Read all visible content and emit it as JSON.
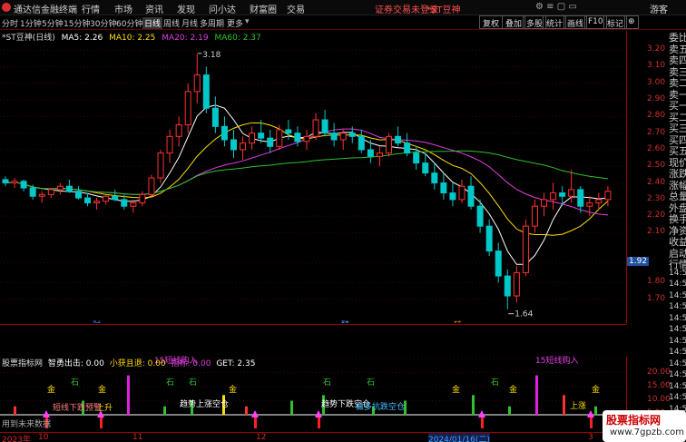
{
  "menubar": {
    "app_title": "通达信金融终端",
    "items": [
      "行情",
      "市场",
      "资讯",
      "发现",
      "问小达",
      "财富圈",
      "交易"
    ],
    "notice": "证券交易未登录",
    "stock_badge": "*ST豆神",
    "guest": "游客"
  },
  "subbar": {
    "periods": [
      "分时",
      "1分钟",
      "5分钟",
      "15分钟",
      "30分钟",
      "60分钟",
      "日线",
      "周线",
      "月线",
      "多周期",
      "更多"
    ],
    "selected": "日线",
    "buttons": [
      "复权",
      "叠加",
      "多股",
      "统计",
      "画线",
      "F10",
      "标记",
      "⊕"
    ]
  },
  "chart_header": {
    "stock": "*ST豆神(日线)",
    "ma5": "MA5: 2.26",
    "ma10": "MA10: 2.25",
    "ma20": "MA20: 2.19",
    "ma60": "MA60: 2.37"
  },
  "y_axis": [
    "3.20",
    "3.10",
    "3.00",
    "2.90",
    "2.80",
    "2.70",
    "2.60",
    "2.50",
    "2.40",
    "2.30",
    "2.20",
    "2.10",
    "1.92",
    "1.80",
    "1.70"
  ],
  "price_labels": {
    "high": "3.18",
    "low": "1.64",
    "current": "1.92"
  },
  "markers": [
    "财",
    "酵",
    "转"
  ],
  "indicator_header": {
    "name": "股票指标网",
    "chuji": "智勇出击: 0.00",
    "xiaohuo": "小获且退: 0.00",
    "zhibiao": "指标: 0.00",
    "get": "GET: 2.35"
  },
  "indicator_y": [
    "20.00",
    "15.00",
    "10.00",
    "5.00",
    "0.00"
  ],
  "indicator_labels": {
    "buy15": "15短线购入",
    "shi": "石",
    "jin": "金",
    "text1": "短线下跌预警",
    "text2": "上升",
    "text3": "趋势上涨空仓",
    "text4": "趋势下跌空仓",
    "text5": "做多抗跌空仓",
    "text6": "上涨",
    "bottom": "用到未来数据"
  },
  "x_axis": [
    "2023年",
    "10",
    "11",
    "12",
    "2024/01/16(二)",
    "3"
  ],
  "side_panel": [
    "委比",
    "卖五",
    "卖四",
    "卖三",
    "卖二",
    "卖一",
    "买一",
    "买二",
    "买三",
    "买四",
    "买五",
    "现价",
    "涨跌",
    "涨幅",
    "总量",
    "外盘",
    "换手",
    "净资",
    "收益",
    "启动",
    "行情",
    "14:5",
    "14:5",
    "14:5",
    "14:5",
    "14:5",
    "14:5",
    "14:5",
    "14:5",
    "14:5",
    "14:5",
    "14:5",
    "14:5",
    "14:5"
  ],
  "watermark": {
    "title": "股票指标网",
    "url": "www.7gpzb.com"
  },
  "colors": {
    "up": "#ff3232",
    "down": "#00c8c8",
    "ma5": "#ffffff",
    "ma10": "#ffdf00",
    "ma20": "#e040e0",
    "ma60": "#30c030",
    "axis": "#d03030"
  },
  "chart_data": {
    "type": "candlestick",
    "x_labels": [
      "2023年",
      "10",
      "11",
      "12",
      "2024/01/16(二)",
      "3"
    ],
    "ylim": [
      1.64,
      3.22
    ],
    "high": 3.18,
    "low": 1.64,
    "current": 1.92,
    "ohlc": [
      [
        2.42,
        2.44,
        2.38,
        2.4
      ],
      [
        2.4,
        2.43,
        2.37,
        2.41
      ],
      [
        2.41,
        2.42,
        2.35,
        2.37
      ],
      [
        2.37,
        2.39,
        2.3,
        2.32
      ],
      [
        2.32,
        2.35,
        2.28,
        2.33
      ],
      [
        2.33,
        2.37,
        2.31,
        2.36
      ],
      [
        2.36,
        2.4,
        2.33,
        2.38
      ],
      [
        2.38,
        2.42,
        2.34,
        2.35
      ],
      [
        2.35,
        2.38,
        2.3,
        2.31
      ],
      [
        2.31,
        2.34,
        2.26,
        2.28
      ],
      [
        2.28,
        2.31,
        2.24,
        2.29
      ],
      [
        2.29,
        2.33,
        2.27,
        2.32
      ],
      [
        2.32,
        2.36,
        2.29,
        2.3
      ],
      [
        2.3,
        2.33,
        2.24,
        2.26
      ],
      [
        2.26,
        2.3,
        2.22,
        2.28
      ],
      [
        2.28,
        2.35,
        2.26,
        2.33
      ],
      [
        2.33,
        2.45,
        2.31,
        2.43
      ],
      [
        2.43,
        2.6,
        2.4,
        2.58
      ],
      [
        2.58,
        2.72,
        2.52,
        2.68
      ],
      [
        2.68,
        2.8,
        2.62,
        2.75
      ],
      [
        2.75,
        3.0,
        2.7,
        2.95
      ],
      [
        2.95,
        3.18,
        2.88,
        3.05
      ],
      [
        3.05,
        3.1,
        2.82,
        2.85
      ],
      [
        2.85,
        2.92,
        2.7,
        2.74
      ],
      [
        2.74,
        2.8,
        2.62,
        2.66
      ],
      [
        2.66,
        2.72,
        2.55,
        2.6
      ],
      [
        2.6,
        2.68,
        2.54,
        2.64
      ],
      [
        2.64,
        2.74,
        2.6,
        2.7
      ],
      [
        2.7,
        2.78,
        2.64,
        2.67
      ],
      [
        2.67,
        2.72,
        2.58,
        2.62
      ],
      [
        2.62,
        2.75,
        2.6,
        2.72
      ],
      [
        2.72,
        2.78,
        2.66,
        2.7
      ],
      [
        2.7,
        2.74,
        2.62,
        2.65
      ],
      [
        2.65,
        2.72,
        2.6,
        2.68
      ],
      [
        2.68,
        2.82,
        2.66,
        2.78
      ],
      [
        2.78,
        2.84,
        2.68,
        2.7
      ],
      [
        2.7,
        2.76,
        2.62,
        2.66
      ],
      [
        2.66,
        2.72,
        2.6,
        2.7
      ],
      [
        2.7,
        2.74,
        2.64,
        2.68
      ],
      [
        2.68,
        2.72,
        2.58,
        2.6
      ],
      [
        2.6,
        2.66,
        2.52,
        2.56
      ],
      [
        2.56,
        2.62,
        2.5,
        2.58
      ],
      [
        2.58,
        2.7,
        2.56,
        2.68
      ],
      [
        2.68,
        2.74,
        2.62,
        2.64
      ],
      [
        2.64,
        2.7,
        2.56,
        2.58
      ],
      [
        2.58,
        2.62,
        2.48,
        2.52
      ],
      [
        2.52,
        2.58,
        2.44,
        2.46
      ],
      [
        2.46,
        2.52,
        2.36,
        2.4
      ],
      [
        2.4,
        2.46,
        2.3,
        2.34
      ],
      [
        2.34,
        2.4,
        2.26,
        2.3
      ],
      [
        2.3,
        2.42,
        2.28,
        2.38
      ],
      [
        2.38,
        2.44,
        2.24,
        2.26
      ],
      [
        2.26,
        2.3,
        2.1,
        2.14
      ],
      [
        2.14,
        2.18,
        1.96,
        1.99
      ],
      [
        1.99,
        2.04,
        1.8,
        1.84
      ],
      [
        1.84,
        1.88,
        1.64,
        1.72
      ],
      [
        1.72,
        1.9,
        1.68,
        1.86
      ],
      [
        1.86,
        2.18,
        1.84,
        2.14
      ],
      [
        2.14,
        2.3,
        2.1,
        2.26
      ],
      [
        2.26,
        2.34,
        2.2,
        2.3
      ],
      [
        2.3,
        2.4,
        2.24,
        2.34
      ],
      [
        2.34,
        2.38,
        2.26,
        2.32
      ],
      [
        2.32,
        2.48,
        2.28,
        2.36
      ],
      [
        2.36,
        2.38,
        2.22,
        2.26
      ],
      [
        2.26,
        2.32,
        2.2,
        2.28
      ],
      [
        2.28,
        2.34,
        2.24,
        2.3
      ],
      [
        2.3,
        2.38,
        2.26,
        2.35
      ]
    ]
  }
}
